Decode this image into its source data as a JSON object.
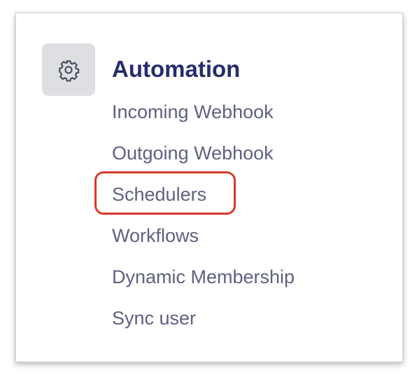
{
  "section": {
    "icon": "gear-icon",
    "title": "Automation"
  },
  "menu": {
    "items": [
      {
        "label": "Incoming Webhook"
      },
      {
        "label": "Outgoing Webhook"
      },
      {
        "label": "Schedulers",
        "highlighted": true
      },
      {
        "label": "Workflows"
      },
      {
        "label": "Dynamic Membership"
      },
      {
        "label": "Sync user"
      }
    ]
  },
  "colors": {
    "title": "#272c6e",
    "menu_text": "#5e6180",
    "icon_tile": "#dedfe3",
    "highlight": "#d93a2a"
  }
}
